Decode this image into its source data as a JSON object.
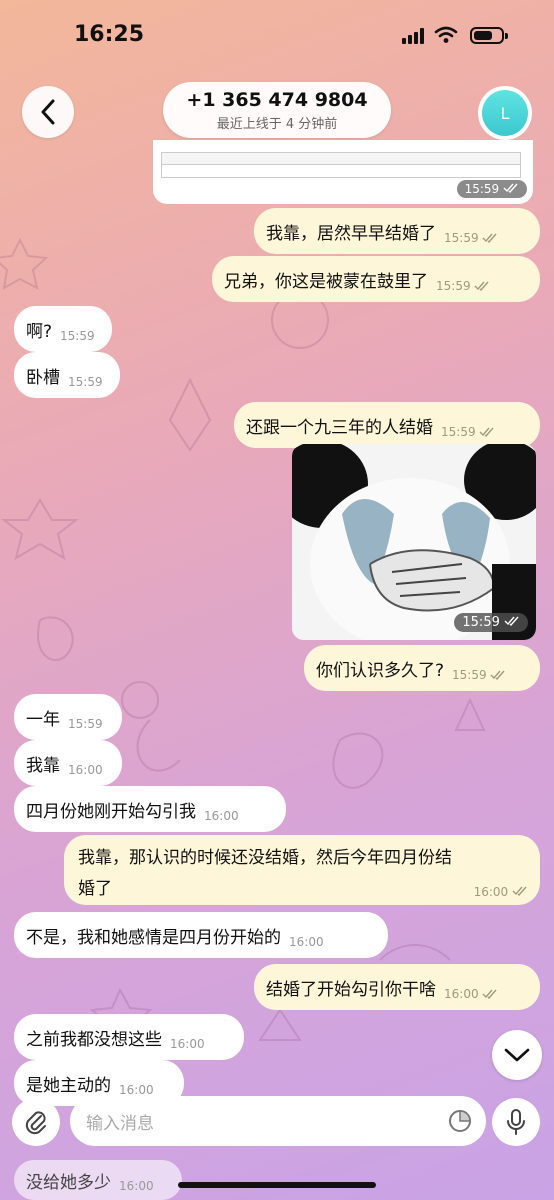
{
  "status": {
    "time": "16:25"
  },
  "header": {
    "contact_name": "+1 365 474 9804",
    "last_seen": "最近上线于 4 分钟前",
    "avatar_letter": "L"
  },
  "doc_message": {
    "time": "15:59"
  },
  "messages": [
    {
      "id": "m1",
      "dir": "out",
      "text": "我靠，居然早早结婚了",
      "time": "15:59"
    },
    {
      "id": "m2",
      "dir": "out",
      "text": "兄弟，你这是被蒙在鼓里了",
      "time": "15:59"
    },
    {
      "id": "m3",
      "dir": "in",
      "text": "啊?",
      "time": "15:59"
    },
    {
      "id": "m4",
      "dir": "in",
      "text": "卧槽",
      "time": "15:59"
    },
    {
      "id": "m5",
      "dir": "out",
      "text": "还跟一个九三年的人结婚",
      "time": "15:59"
    },
    {
      "id": "m6",
      "dir": "out",
      "text": "你们认识多久了?",
      "time": "15:59"
    },
    {
      "id": "m7",
      "dir": "in",
      "text": "一年",
      "time": "15:59"
    },
    {
      "id": "m8",
      "dir": "in",
      "text": "我靠",
      "time": "16:00"
    },
    {
      "id": "m9",
      "dir": "in",
      "text": "四月份她刚开始勾引我",
      "time": "16:00"
    },
    {
      "id": "m10",
      "dir": "out",
      "text_line1": "我靠，那认识的时候还没结婚，然后今年四月份结",
      "text_line2": "婚了",
      "time": "16:00"
    },
    {
      "id": "m11",
      "dir": "in",
      "text": "不是，我和她感情是四月份开始的",
      "time": "16:00"
    },
    {
      "id": "m12",
      "dir": "out",
      "text": "结婚了开始勾引你干啥",
      "time": "16:00"
    },
    {
      "id": "m13",
      "dir": "in",
      "text": "之前我都没想这些",
      "time": "16:00"
    },
    {
      "id": "m14",
      "dir": "in",
      "text": "是她主动的",
      "time": "16:00"
    },
    {
      "id": "m15",
      "dir": "in",
      "text": "没给她多少",
      "time": "16:00"
    }
  ],
  "sticker": {
    "time": "15:59"
  },
  "composer": {
    "placeholder": "输入消息"
  },
  "colors": {
    "outgoing_bubble": "#fdf6d8",
    "incoming_bubble": "#ffffff",
    "avatar": "#4fd6d8",
    "check_color": "#a09a7a"
  }
}
